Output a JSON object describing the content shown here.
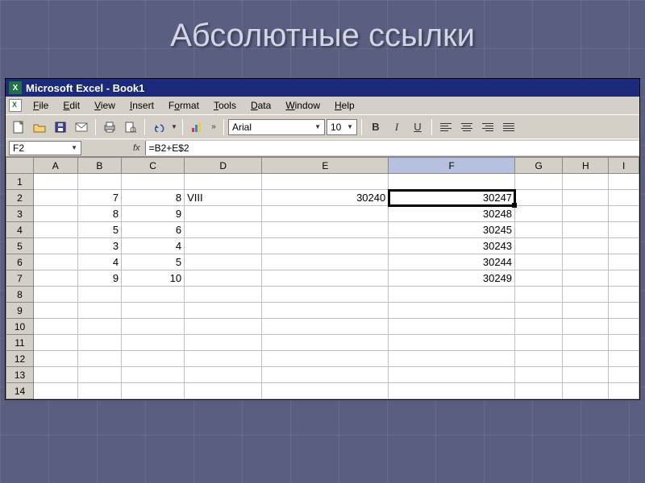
{
  "slide": {
    "title": "Абсолютные ссылки"
  },
  "window": {
    "title": "Microsoft Excel - Book1"
  },
  "menu": {
    "file": "File",
    "edit": "Edit",
    "view": "View",
    "insert": "Insert",
    "format": "Format",
    "tools": "Tools",
    "data": "Data",
    "window": "Window",
    "help": "Help"
  },
  "toolbar": {
    "font_name": "Arial",
    "font_size": "10"
  },
  "formula_bar": {
    "cell_ref": "F2",
    "fx_label": "fx",
    "formula": "=B2+E$2"
  },
  "columns": [
    "A",
    "B",
    "C",
    "D",
    "E",
    "F",
    "G",
    "H",
    "I"
  ],
  "selected_col": "F",
  "selected_cell": "F2",
  "rows": [
    {
      "n": 1,
      "cells": [
        "",
        "",
        "",
        "",
        "",
        "",
        "",
        "",
        ""
      ]
    },
    {
      "n": 2,
      "cells": [
        "",
        "7",
        "8",
        "VIII",
        "30240",
        "30247",
        "",
        "",
        ""
      ]
    },
    {
      "n": 3,
      "cells": [
        "",
        "8",
        "9",
        "",
        "",
        "30248",
        "",
        "",
        ""
      ]
    },
    {
      "n": 4,
      "cells": [
        "",
        "5",
        "6",
        "",
        "",
        "30245",
        "",
        "",
        ""
      ]
    },
    {
      "n": 5,
      "cells": [
        "",
        "3",
        "4",
        "",
        "",
        "30243",
        "",
        "",
        ""
      ]
    },
    {
      "n": 6,
      "cells": [
        "",
        "4",
        "5",
        "",
        "",
        "30244",
        "",
        "",
        ""
      ]
    },
    {
      "n": 7,
      "cells": [
        "",
        "9",
        "10",
        "",
        "",
        "30249",
        "",
        "",
        ""
      ]
    },
    {
      "n": 8,
      "cells": [
        "",
        "",
        "",
        "",
        "",
        "",
        "",
        "",
        ""
      ]
    },
    {
      "n": 9,
      "cells": [
        "",
        "",
        "",
        "",
        "",
        "",
        "",
        "",
        ""
      ]
    },
    {
      "n": 10,
      "cells": [
        "",
        "",
        "",
        "",
        "",
        "",
        "",
        "",
        ""
      ]
    },
    {
      "n": 11,
      "cells": [
        "",
        "",
        "",
        "",
        "",
        "",
        "",
        "",
        ""
      ]
    },
    {
      "n": 12,
      "cells": [
        "",
        "",
        "",
        "",
        "",
        "",
        "",
        "",
        ""
      ]
    },
    {
      "n": 13,
      "cells": [
        "",
        "",
        "",
        "",
        "",
        "",
        "",
        "",
        ""
      ]
    },
    {
      "n": 14,
      "cells": [
        "",
        "",
        "",
        "",
        "",
        "",
        "",
        "",
        ""
      ]
    }
  ]
}
